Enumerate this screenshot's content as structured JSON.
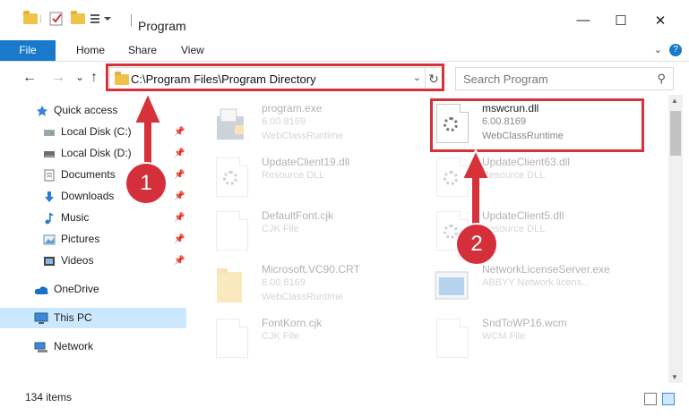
{
  "window": {
    "title": "Program",
    "minimize": "—",
    "maximize": "☐",
    "close": "✕"
  },
  "ribbon": {
    "file": "File",
    "home": "Home",
    "share": "Share",
    "view": "View",
    "help": "?"
  },
  "address": {
    "path": "C:\\Program Files\\Program Directory",
    "refresh": "↻",
    "back": "←",
    "forward": "→",
    "recent": "⌄",
    "up": "↑",
    "dropdown": "⌄"
  },
  "search": {
    "placeholder": "Search Program",
    "icon": "⚲"
  },
  "sidebar": {
    "items": [
      {
        "label": "Quick access",
        "icon": "star-icon"
      },
      {
        "label": "Local Disk (C:)",
        "icon": "drive-icon"
      },
      {
        "label": "Local Disk (D:)",
        "icon": "drive-icon"
      },
      {
        "label": "Documents",
        "icon": "documents-icon"
      },
      {
        "label": "Downloads",
        "icon": "downloads-icon"
      },
      {
        "label": "Music",
        "icon": "music-icon"
      },
      {
        "label": "Pictures",
        "icon": "pictures-icon"
      },
      {
        "label": "Videos",
        "icon": "videos-icon"
      },
      {
        "label": "OneDrive",
        "icon": "cloud-icon"
      },
      {
        "label": "This PC",
        "icon": "computer-icon"
      },
      {
        "label": "Network",
        "icon": "network-icon"
      }
    ],
    "pin": "📌"
  },
  "files": [
    {
      "name": "program.exe",
      "line1": "6.00.8169",
      "line2": "WebClassRuntime"
    },
    {
      "name": "mswcrun.dll",
      "line1": "6.00.8169",
      "line2": "WebClassRuntime"
    },
    {
      "name": "UpdateClient19.dll",
      "line1": "Resource DLL",
      "line2": ""
    },
    {
      "name": "UpdateClient63.dll",
      "line1": "Resource DLL",
      "line2": ""
    },
    {
      "name": "DefaultFont.cjk",
      "line1": "CJK File",
      "line2": ""
    },
    {
      "name": "UpdateClient5.dll",
      "line1": "Resource DLL",
      "line2": ""
    },
    {
      "name": "Microsoft.VC90.CRT",
      "line1": "6.00.8169",
      "line2": "WebClassRuntime"
    },
    {
      "name": "NetworkLicenseServer.exe",
      "line1": "ABBYY Network licens...",
      "line2": ""
    },
    {
      "name": "FontKorn.cjk",
      "line1": "CJK File",
      "line2": ""
    },
    {
      "name": "SndToWP16.wcm",
      "line1": "WCM File",
      "line2": ""
    }
  ],
  "status": {
    "items": "134 items"
  },
  "badges": {
    "one": "1",
    "two": "2"
  },
  "colors": {
    "accent": "#1979ca",
    "highlight": "#d7313a",
    "selected": "#cce8ff"
  }
}
